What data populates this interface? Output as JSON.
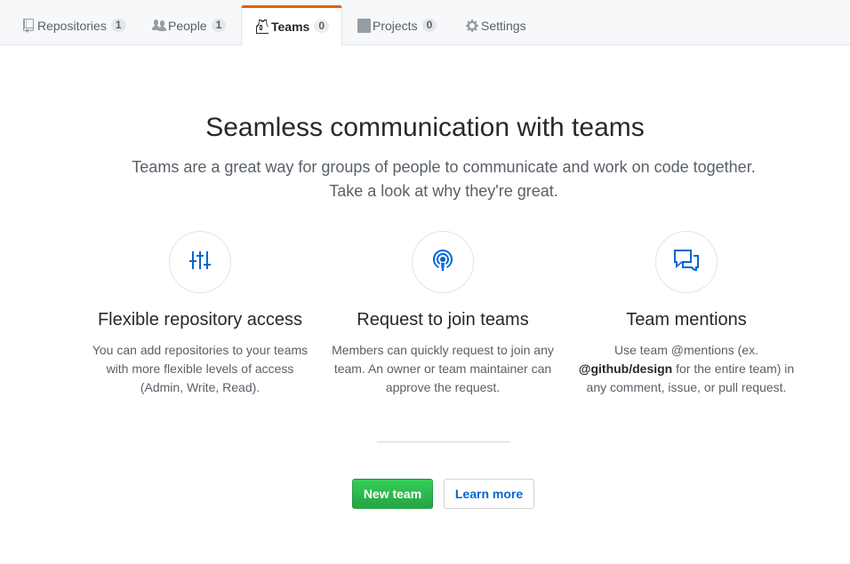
{
  "tabs": [
    {
      "label": "Repositories",
      "count": "1",
      "icon": "repo-icon"
    },
    {
      "label": "People",
      "count": "1",
      "icon": "people-icon"
    },
    {
      "label": "Teams",
      "count": "0",
      "icon": "jersey-icon",
      "selected": true
    },
    {
      "label": "Projects",
      "count": "0",
      "icon": "project-icon"
    },
    {
      "label": "Settings",
      "icon": "gear-icon"
    }
  ],
  "hero": {
    "title": "Seamless communication with teams",
    "subtitle_line1": "Teams are a great way for groups of people to communicate and work on code together.",
    "subtitle_line2": "Take a look at why they're great."
  },
  "features": [
    {
      "icon": "settings-sliders-icon",
      "title": "Flexible repository access",
      "desc_line1": "You can add repositories to your teams",
      "desc_line2": "with more flexible levels of access",
      "desc_line3": "(Admin, Write, Read)."
    },
    {
      "icon": "broadcast-icon",
      "title": "Request to join teams",
      "desc_line1": "Members can quickly request to join any",
      "desc_line2": "team. An owner or team maintainer can",
      "desc_line3": "approve the request."
    },
    {
      "icon": "comment-discussion-icon",
      "title": "Team mentions",
      "desc_line1": "Use team @mentions (ex.",
      "desc_mention": "@github/design",
      "desc_line2_rest": " for the entire team) in",
      "desc_line3": "any comment, issue, or pull request."
    }
  ],
  "actions": {
    "new_team": "New team",
    "learn_more": "Learn more"
  },
  "colors": {
    "accent_tab": "#e36209",
    "primary_button": "#28a745",
    "link": "#0366d6"
  }
}
